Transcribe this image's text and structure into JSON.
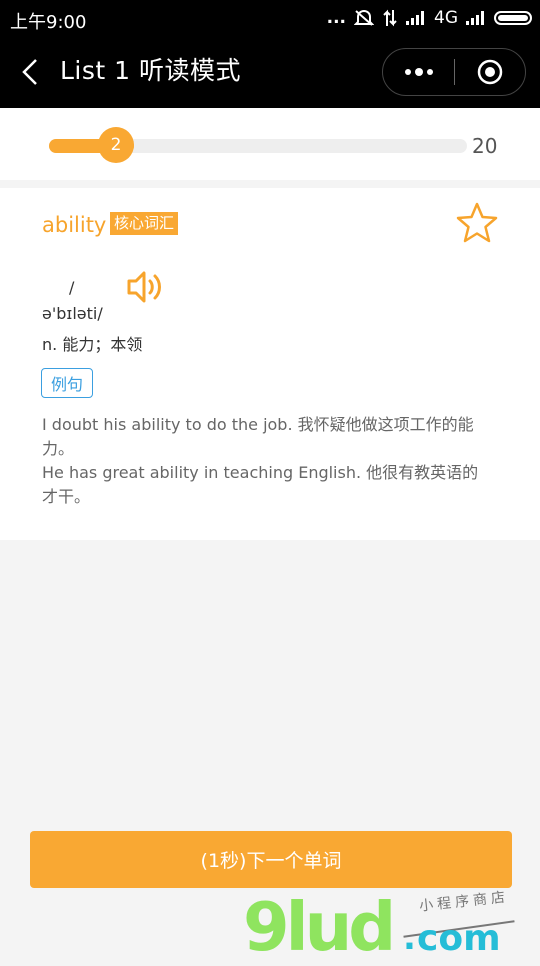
{
  "status_bar": {
    "time": "上午9:00",
    "dots": "...",
    "network": "4G"
  },
  "nav": {
    "title": "List 1 听读模式"
  },
  "progress": {
    "current": "2",
    "total": "20",
    "fraction": 0.16
  },
  "word": {
    "text": "ability",
    "tag": "核心词汇",
    "slash": "/",
    "phonetic": "ə'bɪləti/",
    "meaning": "n. 能力；本领",
    "example_label": "例句",
    "examples": [
      "I doubt his ability to do the job. 我怀疑他做这项工作的能力。",
      "He has great ability in teaching English. 他很有教英语的才干。"
    ]
  },
  "next_button": "(1秒)下一个单词",
  "watermark": {
    "main": "9lud",
    "dot": ".",
    "domain": "com",
    "subtitle": "小程序商店"
  },
  "colors": {
    "accent": "#f9a833",
    "link_blue": "#3b9fe0",
    "watermark_green": "#8fe45f",
    "watermark_cyan": "#25bdd7"
  }
}
